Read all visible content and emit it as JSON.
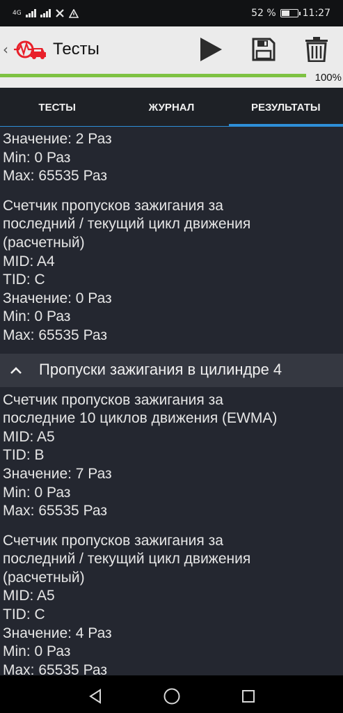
{
  "status_bar": {
    "network": "4G",
    "battery_percent": "52 %",
    "time": "11:27",
    "battery_level": 0.52
  },
  "toolbar": {
    "title": "Тесты",
    "back_icon": "chevron-left-icon",
    "logo_icon": "car-diagnostic-logo",
    "actions": [
      "play-icon",
      "save-icon",
      "trash-icon"
    ]
  },
  "progress": {
    "value": 1.0,
    "label": "100%"
  },
  "tabs": [
    {
      "label": "ТЕСТЫ",
      "active": false
    },
    {
      "label": "ЖУРНАЛ",
      "active": false
    },
    {
      "label": "РЕЗУЛЬТАТЫ",
      "active": true
    }
  ],
  "results": {
    "partial_block": {
      "value": "Значение: 2 Раз",
      "min": "Min: 0 Раз",
      "max": "Max: 65535 Раз"
    },
    "block_a4_c": {
      "title_line1": "Счетчик пропусков зажигания за",
      "title_line2": "последний / текущий цикл движения",
      "title_line3": "(расчетный)",
      "mid": "MID: A4",
      "tid": "TID: C",
      "value": "Значение: 0 Раз",
      "min": "Min: 0 Раз",
      "max": "Max: 65535 Раз"
    },
    "group_header": {
      "title": "Пропуски зажигания в цилиндре 4",
      "icon": "chevron-up-icon"
    },
    "block_a5_b": {
      "title_line1": "Счетчик пропусков зажигания за",
      "title_line2": "последние 10 циклов движения (EWMA)",
      "mid": "MID: A5",
      "tid": "TID: B",
      "value": "Значение: 7 Раз",
      "min": "Min: 0 Раз",
      "max": "Max: 65535 Раз"
    },
    "block_a5_c": {
      "title_line1": "Счетчик пропусков зажигания за",
      "title_line2": "последний / текущий цикл движения",
      "title_line3": "(расчетный)",
      "mid": "MID: A5",
      "tid": "TID: C",
      "value": "Значение: 4 Раз",
      "min": "Min: 0 Раз",
      "max": "Max: 65535 Раз"
    }
  },
  "nav_bar": [
    "back-triangle-icon",
    "home-circle-icon",
    "recents-square-icon"
  ],
  "colors": {
    "accent_blue": "#2e8fd8",
    "progress_green": "#7ec242",
    "logo_red": "#e8202a",
    "background": "#242730"
  }
}
